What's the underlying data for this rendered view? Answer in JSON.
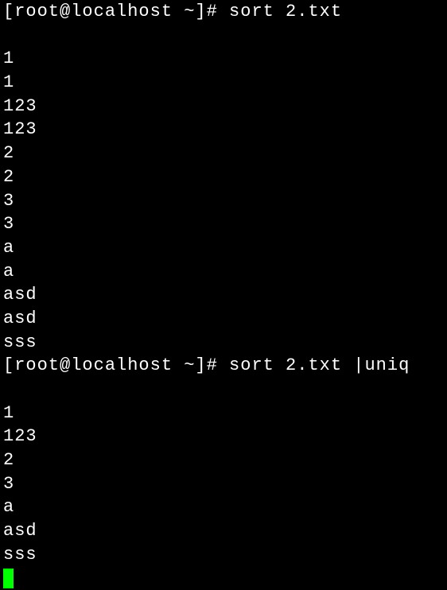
{
  "top_fragment": "",
  "prompt1": {
    "prefix": "[root@localhost ~]# ",
    "command": "sort 2.txt"
  },
  "output1": {
    "l0": "1",
    "l1": "1",
    "l2": "123",
    "l3": "123",
    "l4": "2",
    "l5": "2",
    "l6": "3",
    "l7": "3",
    "l8": "a",
    "l9": "a",
    "l10": "asd",
    "l11": "asd",
    "l12": "sss"
  },
  "prompt2": {
    "prefix": "[root@localhost ~]# ",
    "command": "sort 2.txt |uniq"
  },
  "output2": {
    "l0": "1",
    "l1": "123",
    "l2": "2",
    "l3": "3",
    "l4": "a",
    "l5": "asd",
    "l6": "sss"
  },
  "prompt3": {
    "prefix": ""
  }
}
